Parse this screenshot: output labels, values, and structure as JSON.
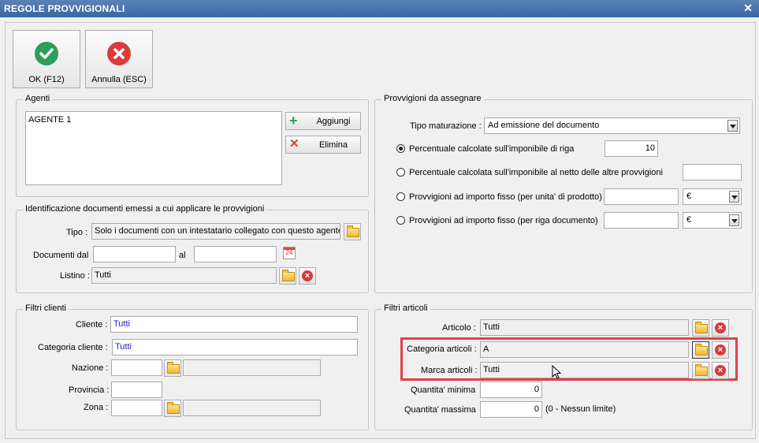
{
  "window": {
    "title": "REGOLE PROVVIGIONALI",
    "close_icon": "close-icon"
  },
  "toolbar": {
    "ok_label": "OK (F12)",
    "cancel_label": "Annulla (ESC)"
  },
  "agenti": {
    "legend": "Agenti",
    "items": [
      "AGENTE 1"
    ],
    "add_label": "Aggiungi",
    "delete_label": "Elimina"
  },
  "identificazione": {
    "legend": "Identificazione documenti emessi a cui applicare le provvigioni",
    "tipo_label": "Tipo :",
    "tipo_value": "Solo i documenti con un intestatario collegato con questo agente",
    "documenti_label": "Documenti dal",
    "dal_value": "",
    "al_label": "al",
    "al_value": "",
    "calendar_text": "24",
    "listino_label": "Listino :",
    "listino_value": "Tutti"
  },
  "provvigioni": {
    "legend": "Provvigioni da assegnare",
    "tipo_maturazione_label": "Tipo maturazione :",
    "tipo_maturazione_value": "Ad emissione del documento",
    "options": [
      {
        "label": "Percentuale calcolate sull'imponibile di riga",
        "value": "10",
        "selected": true
      },
      {
        "label": "Percentuale calcolata sull'imponibile al netto delle altre provvigioni",
        "value": "",
        "selected": false
      },
      {
        "label": "Provvigioni ad importo fisso (per unita' di prodotto)",
        "value": "",
        "currency": "€",
        "selected": false
      },
      {
        "label": "Provvigioni ad importo fisso (per riga documento)",
        "value": "",
        "currency": "€",
        "selected": false
      }
    ]
  },
  "filtri_clienti": {
    "legend": "Filtri clienti",
    "cliente_label": "Cliente :",
    "cliente_value": "Tutti",
    "categoria_label": "Categoria cliente :",
    "categoria_value": "Tutti",
    "nazione_label": "Nazione :",
    "nazione_value": "",
    "nazione_desc": "",
    "provincia_label": "Provincia :",
    "provincia_value": "",
    "zona_label": "Zona :",
    "zona_value": "",
    "zona_desc": ""
  },
  "filtri_articoli": {
    "legend": "Filtri articoli",
    "articolo_label": "Articolo :",
    "articolo_value": "Tutti",
    "categoria_label": "Categoria articoli :",
    "categoria_value": "A",
    "marca_label": "Marca articoli :",
    "marca_value": "Tutti",
    "qmin_label": "Quantita' minima",
    "qmin_value": "0",
    "qmax_label": "Quantita' massima",
    "qmax_value": "0",
    "qmax_note": "(0 - Nessun limite)"
  },
  "colors": {
    "accent_red": "#e0404a",
    "ok_green": "#2e9e5b",
    "cancel_red": "#d83c3c",
    "link_blue": "#1c1ccc"
  }
}
